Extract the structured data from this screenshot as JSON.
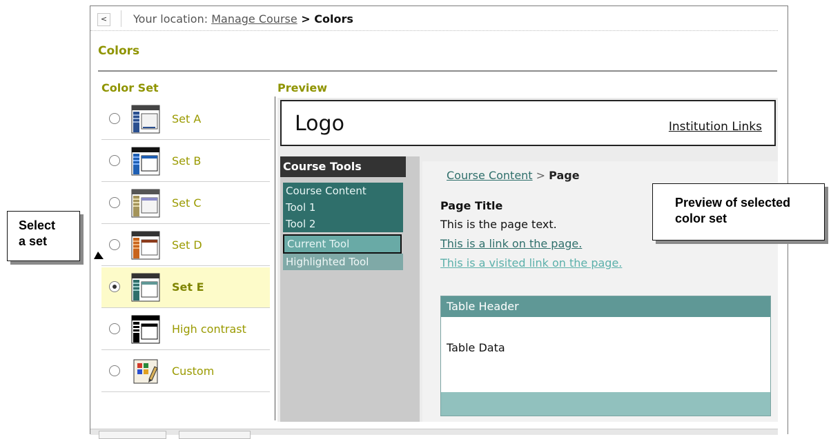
{
  "breadcrumb": {
    "back_label": "<",
    "prefix": "Your location: ",
    "parent_link": "Manage Course",
    "separator": " > ",
    "current": "Colors"
  },
  "page_title": "Colors",
  "headings": {
    "color_set": "Color Set",
    "preview": "Preview"
  },
  "color_sets": [
    {
      "label": "Set A",
      "selected": false,
      "thumb_accent": "#2a4f8f"
    },
    {
      "label": "Set B",
      "selected": false,
      "thumb_accent": "#1f5fb3"
    },
    {
      "label": "Set C",
      "selected": false,
      "thumb_accent": "#a4945a"
    },
    {
      "label": "Set D",
      "selected": false,
      "thumb_accent": "#c8641c"
    },
    {
      "label": "Set E",
      "selected": true,
      "thumb_accent": "#2f6f6b"
    },
    {
      "label": "High contrast",
      "selected": false,
      "thumb_accent": "#000000"
    },
    {
      "label": "Custom",
      "selected": false,
      "thumb_accent": "#e0a020"
    }
  ],
  "preview": {
    "logo": "Logo",
    "institution_links": "Institution Links",
    "course_tools_header": "Course Tools",
    "tools": [
      "Course Content",
      "Tool 1",
      "Tool 2",
      "Current Tool",
      "Highlighted Tool"
    ],
    "content_crumb_link": "Course Content",
    "content_crumb_sep": " > ",
    "content_crumb_current": "Page",
    "page_title": "Page Title",
    "page_text": "This is the page text.",
    "link_text": "This is a link on the page.",
    "visited_link_text": "This is a visited link on the page.",
    "table_header": "Table Header",
    "table_data": "Table Data"
  },
  "callouts": {
    "select_line1": "Select",
    "select_line2": "a set",
    "preview_line1": "Preview of selected",
    "preview_line2": "color set"
  },
  "colors": {
    "accent_olive": "#8f9400",
    "tool_teal": "#2f6f6b",
    "selected_row_bg": "#fdfbc9"
  }
}
